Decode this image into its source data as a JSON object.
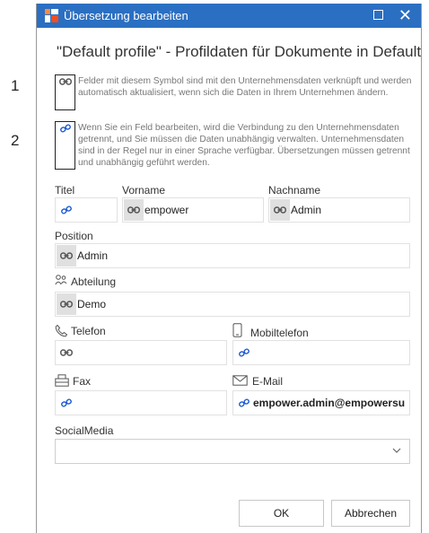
{
  "callouts": [
    "1",
    "2"
  ],
  "dialog": {
    "title": "Übersetzung bearbeiten",
    "heading": "\"Default profile\" - Profildaten für Dokumente in Default",
    "info_linked": "Felder mit diesem Symbol sind mit den Unternehmensdaten verknüpft und werden automatisch aktualisiert, wenn sich die Daten in Ihrem Unternehmen ändern.",
    "info_unlinked": "Wenn Sie ein Feld bearbeiten, wird die Verbindung zu den Unternehmensdaten getrennt, und Sie müssen die Daten unabhängig verwalten. Unternehmensdaten sind in der Regel nur in einer Sprache verfügbar. Übersetzungen müssen getrennt und unabhängig geführt werden."
  },
  "form": {
    "titel": {
      "label": "Titel",
      "value": "",
      "link_state": "unlinked"
    },
    "vorname": {
      "label": "Vorname",
      "value": "empower",
      "link_state": "linked"
    },
    "nachname": {
      "label": "Nachname",
      "value": "Admin",
      "link_state": "linked"
    },
    "position": {
      "label": "Position",
      "value": "Admin",
      "link_state": "linked"
    },
    "abteilung": {
      "label": "Abteilung",
      "value": "Demo",
      "link_state": "linked",
      "icon": "org-chart-icon"
    },
    "telefon": {
      "label": "Telefon",
      "value": "",
      "link_state": "linked",
      "icon": "phone-icon"
    },
    "mobiltelefon": {
      "label": "Mobiltelefon",
      "value": "",
      "link_state": "unlinked",
      "icon": "mobile-phone-icon"
    },
    "fax": {
      "label": "Fax",
      "value": "",
      "link_state": "unlinked",
      "icon": "fax-icon"
    },
    "email": {
      "label": "E-Mail",
      "value": "empower.admin@empowersu",
      "link_state": "unlinked",
      "icon": "envelope-icon"
    },
    "socialmedia": {
      "label": "SocialMedia",
      "value": ""
    }
  },
  "buttons": {
    "ok": "OK",
    "cancel": "Abbrechen"
  },
  "colors": {
    "titlebar": "#2b6fc2",
    "link_icon": "#555555",
    "unlink_icon": "#1e5bd0",
    "badge_bg": "#e0e0e0"
  }
}
